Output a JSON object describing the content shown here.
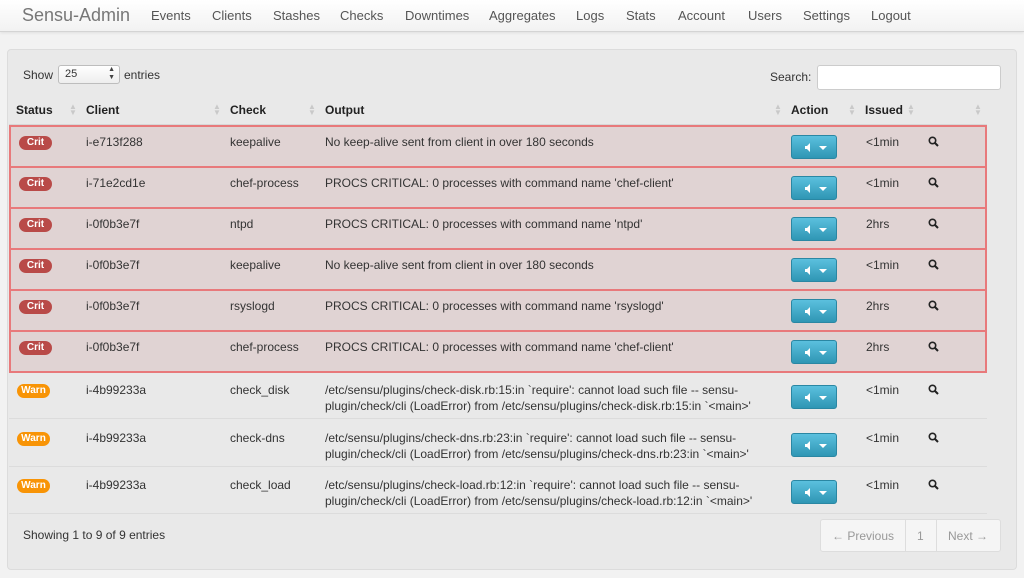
{
  "app": {
    "brand": "Sensu-Admin",
    "nav": [
      "Events",
      "Clients",
      "Stashes",
      "Checks",
      "Downtimes",
      "Aggregates",
      "Logs",
      "Stats",
      "Account",
      "Users",
      "Settings",
      "Logout"
    ]
  },
  "table_controls": {
    "show_label": "Show",
    "page_length": "25",
    "entries_label": "entries",
    "search_label": "Search:",
    "search_value": ""
  },
  "columns": [
    "Status",
    "Client",
    "Check",
    "Output",
    "Action",
    "Issued"
  ],
  "events": [
    {
      "status": "Crit",
      "client": "i-e713f288",
      "check": "keepalive",
      "output": "No keep-alive sent from client in over 180 seconds",
      "issued": "<1min"
    },
    {
      "status": "Crit",
      "client": "i-71e2cd1e",
      "check": "chef-process",
      "output": "PROCS CRITICAL: 0 processes with command name 'chef-client'",
      "issued": "<1min"
    },
    {
      "status": "Crit",
      "client": "i-0f0b3e7f",
      "check": "ntpd",
      "output": "PROCS CRITICAL: 0 processes with command name 'ntpd'",
      "issued": "2hrs"
    },
    {
      "status": "Crit",
      "client": "i-0f0b3e7f",
      "check": "keepalive",
      "output": "No keep-alive sent from client in over 180 seconds",
      "issued": "<1min"
    },
    {
      "status": "Crit",
      "client": "i-0f0b3e7f",
      "check": "rsyslogd",
      "output": "PROCS CRITICAL: 0 processes with command name 'rsyslogd'",
      "issued": "2hrs"
    },
    {
      "status": "Crit",
      "client": "i-0f0b3e7f",
      "check": "chef-process",
      "output": "PROCS CRITICAL: 0 processes with command name 'chef-client'",
      "issued": "2hrs"
    },
    {
      "status": "Warn",
      "client": "i-4b99233a",
      "check": "check_disk",
      "output": "/etc/sensu/plugins/check-disk.rb:15:in `require': cannot load such file -- sensu-plugin/check/cli (LoadError) from /etc/sensu/plugins/check-disk.rb:15:in `<main>'",
      "issued": "<1min"
    },
    {
      "status": "Warn",
      "client": "i-4b99233a",
      "check": "check-dns",
      "output": "/etc/sensu/plugins/check-dns.rb:23:in `require': cannot load such file -- sensu-plugin/check/cli (LoadError) from /etc/sensu/plugins/check-dns.rb:23:in `<main>'",
      "issued": "<1min"
    },
    {
      "status": "Warn",
      "client": "i-4b99233a",
      "check": "check_load",
      "output": "/etc/sensu/plugins/check-load.rb:12:in `require': cannot load such file -- sensu-plugin/check/cli (LoadError) from /etc/sensu/plugins/check-load.rb:12:in `<main>'",
      "issued": "<1min"
    }
  ],
  "footer": {
    "info": "Showing 1 to 9 of 9 entries",
    "prev": "← Previous",
    "page": "1",
    "next": "Next →"
  },
  "colors": {
    "crit": "#b94a48",
    "warn": "#f89406",
    "crit_row_border": "#e8797b",
    "action_button": "#2f96b4"
  },
  "icons": {
    "action": "speaker-icon",
    "details": "magnifier-icon"
  }
}
